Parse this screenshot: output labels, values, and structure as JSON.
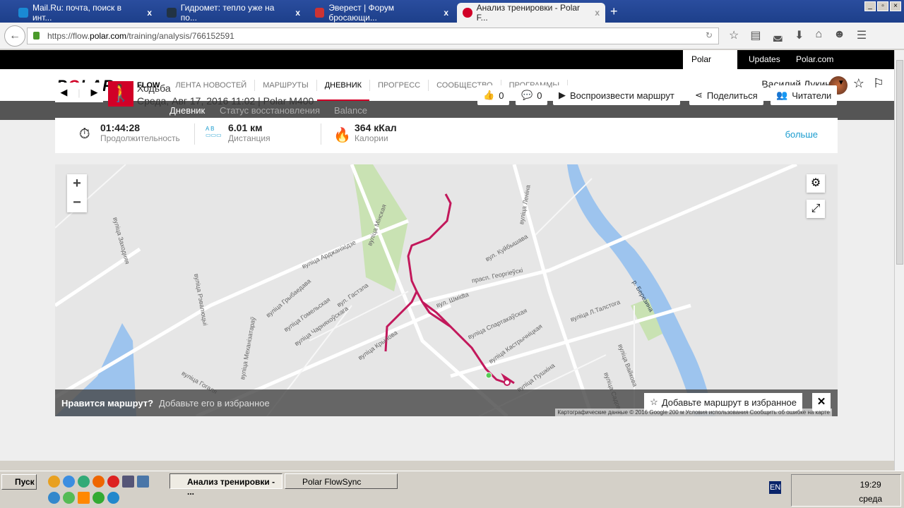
{
  "browser": {
    "tabs": [
      {
        "title": "Mail.Ru: почта, поиск в инт...",
        "color": "#1a8ad4"
      },
      {
        "title": "Гидромет: тепло уже на по...",
        "color": "#234"
      },
      {
        "title": "Эверест | Форум бросающи...",
        "color": "#c33"
      },
      {
        "title": "Анализ тренировки - Polar F...",
        "color": "#d10027"
      }
    ],
    "close": "x",
    "new_tab": "+",
    "url_prefix": "https://flow.",
    "url_domain": "polar.com",
    "url_path": "/training/analysis/766152591"
  },
  "site": {
    "top_links": [
      "Polar Flow",
      "Updates",
      "Polar.com"
    ],
    "logo": "POLAR",
    "nav": [
      "FLOW",
      "ЛЕНТА НОВОСТЕЙ",
      "МАРШРУТЫ",
      "ДНЕВНИК",
      "ПРОГРЕСС",
      "СООБЩЕСТВО",
      "ПРОГРАММЫ"
    ],
    "user": "Василий Лукин",
    "subnav": [
      "Дневник",
      "Статус восстановления",
      "Balance"
    ]
  },
  "training": {
    "sport": "Ходьба",
    "date": "Среда, Авг 17, 2016 11:02 | Polar M400",
    "likes": "0",
    "comments": "0",
    "play_route": "Воспроизвести маршрут",
    "share": "Поделиться",
    "readers": "Читатели",
    "stats": [
      {
        "value": "01:44:28",
        "label": "Продолжительность"
      },
      {
        "value": "6.01 км",
        "label": "Дистанция",
        "ab": "A  B"
      },
      {
        "value": "364 кКал",
        "label": "Калории"
      }
    ],
    "more": "больше"
  },
  "map": {
    "zoom_in": "+",
    "zoom_out": "−",
    "streets": [
      "вуліца Мінская",
      "вуліца Леніна",
      "прасп. Георгіеўскі",
      "вул. Куйбышава",
      "вуліца Арджанікідзе",
      "вул. Гастэла",
      "вул. Шміdta",
      "вуліца Спартакаўская",
      "вуліца Кастрычніцкая",
      "вуліца Пушкіна",
      "вуліца Л.Талстога",
      "вуліца Вайкова",
      "вуліца Садовая",
      "вуліца Крылова",
      "вуліца Гогаля",
      "вуліца Механізатараў",
      "р. Березина",
      "вуліца Заходняя",
      "вуліца Рэвалюцыі",
      "вуліца Гомельская",
      "вуліца Чарняхоўскага",
      "вуліца Грыбаедава"
    ],
    "question": "Нравится маршрут?",
    "hint": "Добавьте его в избранное",
    "fav_button": "Добавьте маршрут в избранное",
    "attribution": "Картографические данные © 2016 Google   200 м   Условия использования   Сообщить об ошибке на карте",
    "route_color": "#c2185b"
  },
  "taskbar": {
    "start": "Пуск",
    "tasks": [
      "Анализ тренировки - ...",
      "Polar FlowSync"
    ],
    "lang": "EN",
    "time": "19:29",
    "day": "среда"
  }
}
